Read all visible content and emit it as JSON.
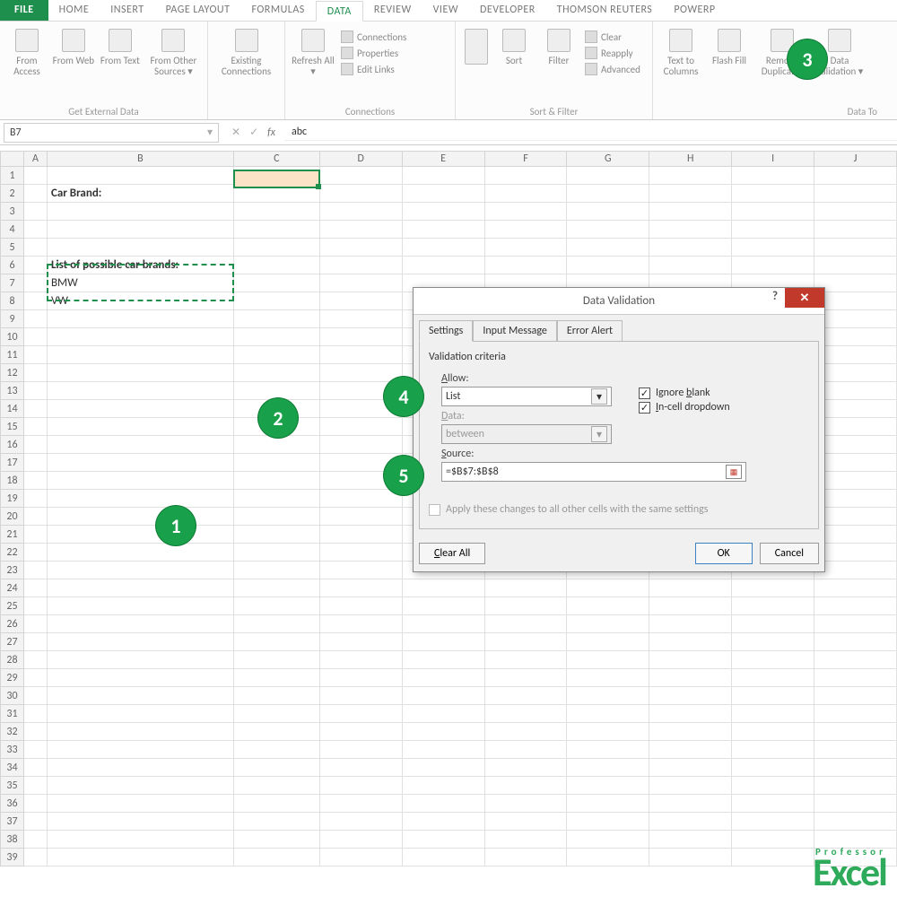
{
  "tabs": {
    "file": "FILE",
    "home": "HOME",
    "insert": "INSERT",
    "layout": "PAGE LAYOUT",
    "formulas": "FORMULAS",
    "data": "DATA",
    "review": "REVIEW",
    "view": "VIEW",
    "developer": "DEVELOPER",
    "tr": "THOMSON REUTERS",
    "power": "POWERP"
  },
  "ribbon": {
    "access": "From Access",
    "web": "From Web",
    "text": "From Text",
    "other": "From Other Sources ▾",
    "existing": "Existing Connections",
    "refresh": "Refresh All ▾",
    "conn": "Connections",
    "props": "Properties",
    "links": "Edit Links",
    "sort": "Sort",
    "filter": "Filter",
    "clear": "Clear",
    "reapply": "Reapply",
    "advanced": "Advanced",
    "t2c": "Text to Columns",
    "flash": "Flash Fill",
    "dup": "Remove Duplicates",
    "dv": "Data Validation ▾",
    "g1": "Get External Data",
    "g2": "Connections",
    "g3": "Sort & Filter",
    "g4": "Data To"
  },
  "namebox": "B7",
  "fx_value": "abc",
  "columns": [
    "",
    "A",
    "B",
    "C",
    "D",
    "E",
    "F",
    "G",
    "H",
    "I",
    "J"
  ],
  "rows": [
    "1",
    "2",
    "3",
    "4",
    "5",
    "6",
    "7",
    "8",
    "9",
    "10",
    "11",
    "12",
    "13",
    "14",
    "15",
    "16",
    "17",
    "18",
    "19",
    "20",
    "21",
    "22",
    "23",
    "24",
    "25",
    "26",
    "27",
    "28",
    "29",
    "30",
    "31",
    "32",
    "33",
    "34",
    "35",
    "36",
    "37",
    "38",
    "39"
  ],
  "cells": {
    "B2": "Car Brand:",
    "B6": "List of possible car brands:",
    "B7": "BMW",
    "B8": "VW"
  },
  "dialog": {
    "title": "Data Validation",
    "tab1": "Settings",
    "tab2": "Input Message",
    "tab3": "Error Alert",
    "criteria": "Validation criteria",
    "allow_lbl": "Allow:",
    "allow_val": "List",
    "data_lbl": "Data:",
    "data_val": "between",
    "src_lbl": "Source:",
    "src_val": "=$B$7:$B$8",
    "ignore": "Ignore blank",
    "incell": "In-cell dropdown",
    "apply": "Apply these changes to all other cells with the same settings",
    "clear": "Clear All",
    "ok": "OK",
    "cancel": "Cancel"
  },
  "anno": {
    "a1": "1",
    "a2": "2",
    "a3": "3",
    "a4": "4",
    "a5": "5"
  },
  "logo": {
    "brand": "Excel",
    "sub": "Professor"
  }
}
